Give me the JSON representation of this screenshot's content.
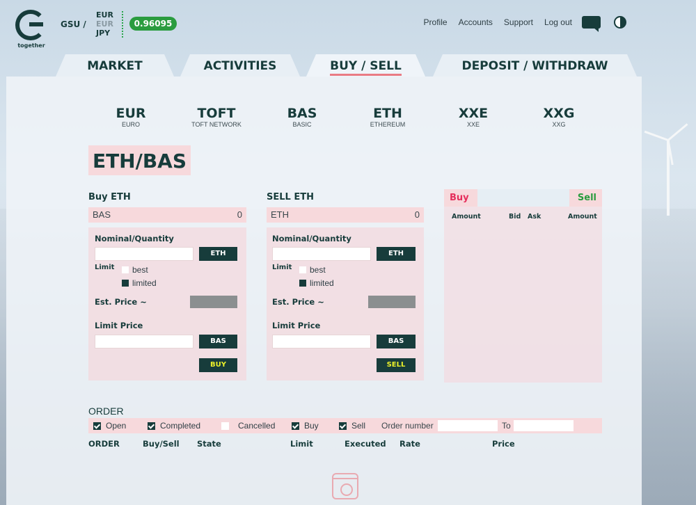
{
  "header": {
    "logo_text": "together",
    "gsu": "GSU /",
    "currencies": [
      "EUR",
      "EUR",
      "JPY"
    ],
    "rate": "0.96095",
    "nav": [
      "Profile",
      "Accounts",
      "Support",
      "Log out"
    ]
  },
  "tabs": [
    {
      "label": "MARKET"
    },
    {
      "label": "ACTIVITIES"
    },
    {
      "label": "BUY / SELL"
    },
    {
      "label": "DEPOSIT / WITHDRAW"
    }
  ],
  "assets": [
    {
      "code": "EUR",
      "name": "EURO"
    },
    {
      "code": "TOFT",
      "name": "TOFT NETWORK"
    },
    {
      "code": "BAS",
      "name": "BASIC"
    },
    {
      "code": "ETH",
      "name": "ETHEREUM"
    },
    {
      "code": "XXE",
      "name": "XXE"
    },
    {
      "code": "XXG",
      "name": "XXG"
    }
  ],
  "pair": "ETH/BAS",
  "buy": {
    "title": "Buy ETH",
    "balance_label": "BAS",
    "balance_value": "0",
    "nominal_label": "Nominal/Quantity",
    "unit_button": "ETH",
    "limit_label": "Limit",
    "opt_best": "best",
    "opt_limited": "limited",
    "est_label": "Est. Price ~",
    "limit_price_label": "Limit Price",
    "price_button": "BAS",
    "action": "BUY"
  },
  "sell": {
    "title": "SELL ETH",
    "balance_label": "ETH",
    "balance_value": "0",
    "nominal_label": "Nominal/Quantity",
    "unit_button": "ETH",
    "limit_label": "Limit",
    "opt_best": "best",
    "opt_limited": "limited",
    "est_label": "Est. Price ~",
    "limit_price_label": "Limit Price",
    "price_button": "BAS",
    "action": "SELL"
  },
  "book": {
    "buy_tab": "Buy",
    "sell_tab": "Sell",
    "cols": [
      "Amount",
      "Bid",
      "Ask",
      "Amount"
    ]
  },
  "orders": {
    "title": "ORDER",
    "filters": [
      "Open",
      "Completed",
      "Cancelled",
      "Buy",
      "Sell"
    ],
    "order_number_label": "Order number",
    "to_label": "To",
    "cols": [
      "ORDER",
      "Buy/Sell",
      "State",
      "Limit",
      "Executed",
      "Rate",
      "Price"
    ]
  }
}
